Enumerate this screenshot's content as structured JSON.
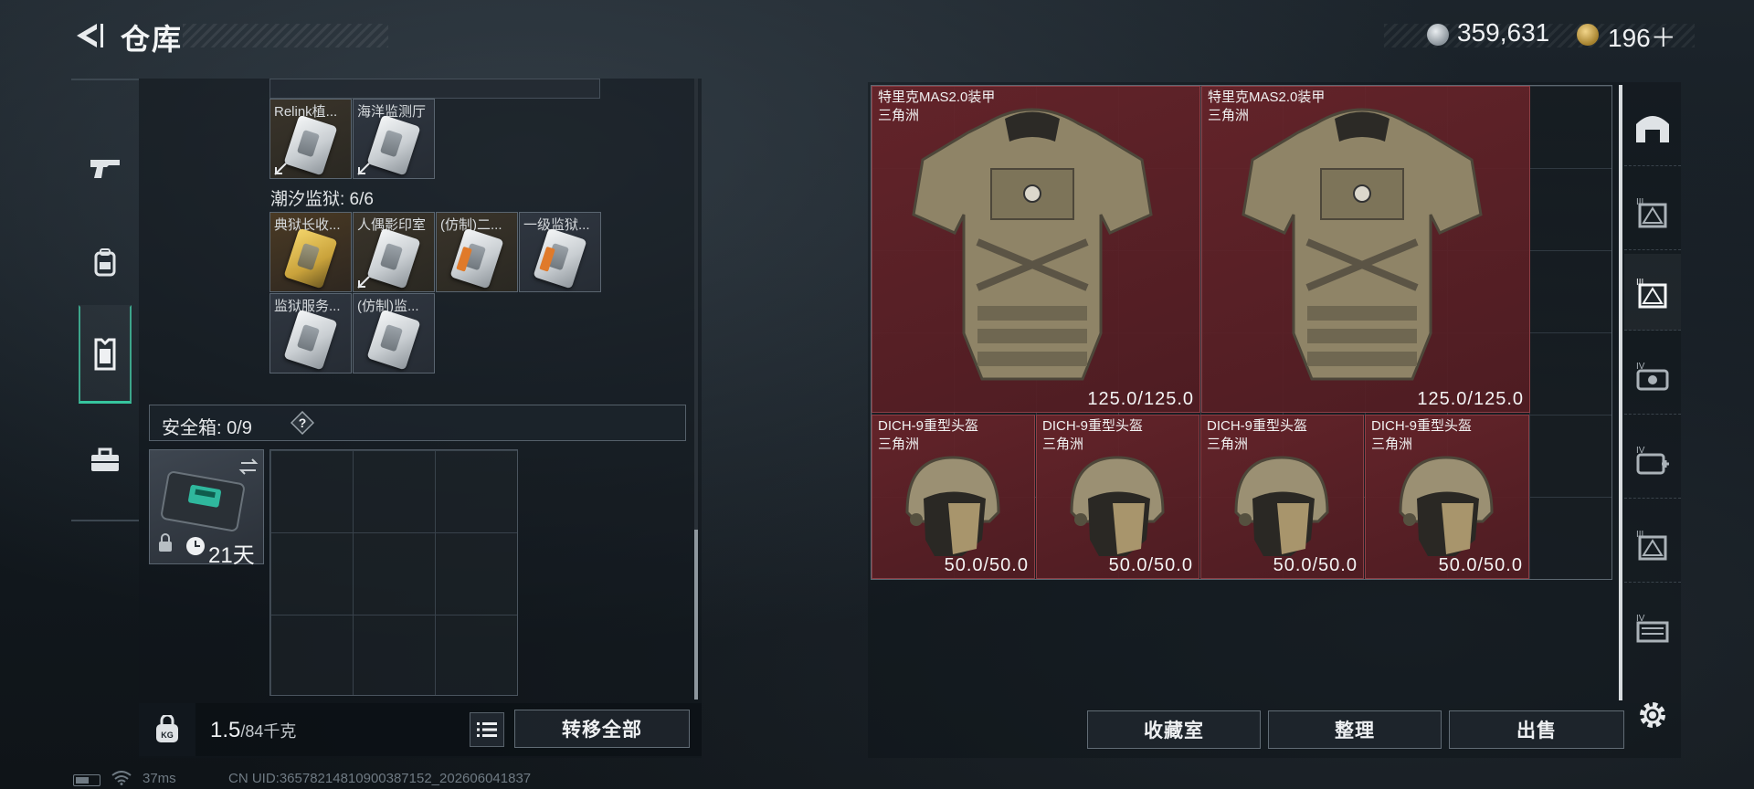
{
  "header": {
    "title": "仓库",
    "currency_silver": "359,631",
    "currency_gold": "196＋"
  },
  "left_nav": {
    "items": [
      "weapon-icon",
      "backpack-icon",
      "vest-icon",
      "toolbox-icon"
    ],
    "active_index": 2
  },
  "warehouse": {
    "top_row_labels": [
      "Relink植...",
      "海洋监测厅"
    ],
    "section_prison": {
      "label": "潮汐监狱: 6/6",
      "cards": [
        "典狱长收...",
        "人偶影印室",
        "(仿制)二...",
        "一级监狱...",
        "监狱服务...",
        "(仿制)监..."
      ]
    },
    "safe_box": {
      "label": "安全箱: 0/9",
      "help": "?",
      "timer": "21天"
    },
    "weight": {
      "current": "1.5",
      "capacity": "/84千克"
    },
    "transfer_all_label": "转移全部"
  },
  "container": {
    "armor_items": [
      {
        "name": "特里克MAS2.0装甲",
        "map": "三角洲",
        "durability": "125.0/125.0"
      },
      {
        "name": "特里克MAS2.0装甲",
        "map": "三角洲",
        "durability": "125.0/125.0"
      }
    ],
    "helmet_items": [
      {
        "name": "DICH-9重型头盔",
        "map": "三角洲",
        "durability": "50.0/50.0"
      },
      {
        "name": "DICH-9重型头盔",
        "map": "三角洲",
        "durability": "50.0/50.0"
      },
      {
        "name": "DICH-9重型头盔",
        "map": "三角洲",
        "durability": "50.0/50.0"
      },
      {
        "name": "DICH-9重型头盔",
        "map": "三角洲",
        "durability": "50.0/50.0"
      }
    ],
    "side_tabs": [
      "safehouse-icon",
      "tier-III-container-icon",
      "tier-III-active-container-icon",
      "tier-IV-case-icon",
      "tier-IV-medkit-icon",
      "tier-III-box-icon",
      "tier-IV-folder-icon"
    ],
    "buttons": {
      "collection": "收藏室",
      "sort": "整理",
      "sell": "出售"
    }
  },
  "status_bar": {
    "ping": "37ms",
    "uid": "CN UID:3657821481090038715​2_202606041837"
  },
  "colors": {
    "accent": "#36c59e",
    "item_bg": "#692a2f",
    "panel_border": "#5c6770"
  }
}
